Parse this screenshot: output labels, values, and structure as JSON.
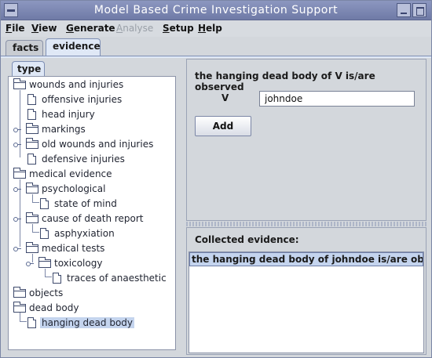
{
  "window": {
    "title": "Model Based Crime Investigation Support"
  },
  "menu": [
    {
      "label": "File",
      "enabled": true
    },
    {
      "label": "View",
      "enabled": true
    },
    {
      "label": "Generate",
      "enabled": true
    },
    {
      "label": "Analyse",
      "enabled": false
    },
    {
      "label": "Setup",
      "enabled": true
    },
    {
      "label": "Help",
      "enabled": true
    }
  ],
  "tabs": [
    {
      "label": "facts",
      "selected": false
    },
    {
      "label": "evidence",
      "selected": true
    }
  ],
  "left_panel": {
    "tab": "type",
    "tree": [
      {
        "label": "wounds and injuries",
        "type": "folder",
        "depth": 0
      },
      {
        "label": "offensive injuries",
        "type": "leaf",
        "depth": 1
      },
      {
        "label": "head injury",
        "type": "leaf",
        "depth": 1
      },
      {
        "label": "markings",
        "type": "folder",
        "depth": 1,
        "collapsed": true
      },
      {
        "label": "old wounds and injuries",
        "type": "folder",
        "depth": 1,
        "collapsed": true
      },
      {
        "label": "defensive injuries",
        "type": "leaf",
        "depth": 1
      },
      {
        "label": "medical evidence",
        "type": "folder",
        "depth": 0
      },
      {
        "label": "psychological",
        "type": "folder",
        "depth": 1
      },
      {
        "label": "state of mind",
        "type": "leaf",
        "depth": 2
      },
      {
        "label": "cause of death report",
        "type": "folder",
        "depth": 1
      },
      {
        "label": "asphyxiation",
        "type": "leaf",
        "depth": 2
      },
      {
        "label": "medical tests",
        "type": "folder",
        "depth": 1
      },
      {
        "label": "toxicology",
        "type": "folder",
        "depth": 2
      },
      {
        "label": "traces of anaesthetic",
        "type": "leaf",
        "depth": 3
      },
      {
        "label": "objects",
        "type": "folder",
        "depth": 0
      },
      {
        "label": "dead body",
        "type": "folder",
        "depth": 0
      },
      {
        "label": "hanging dead body",
        "type": "leaf",
        "depth": 1,
        "selected": true
      }
    ]
  },
  "form": {
    "title": "the hanging dead body of V is/are observed",
    "variable_label": "V",
    "variable_value": "johndoe",
    "add_label": "Add"
  },
  "collected": {
    "label": "Collected evidence:",
    "items": [
      "the hanging dead body of johndoe is/are observed"
    ]
  },
  "colors": {
    "titlebar": "#7f8ab6",
    "selection": "#c4d4ee",
    "panel": "#d3d7dc"
  }
}
